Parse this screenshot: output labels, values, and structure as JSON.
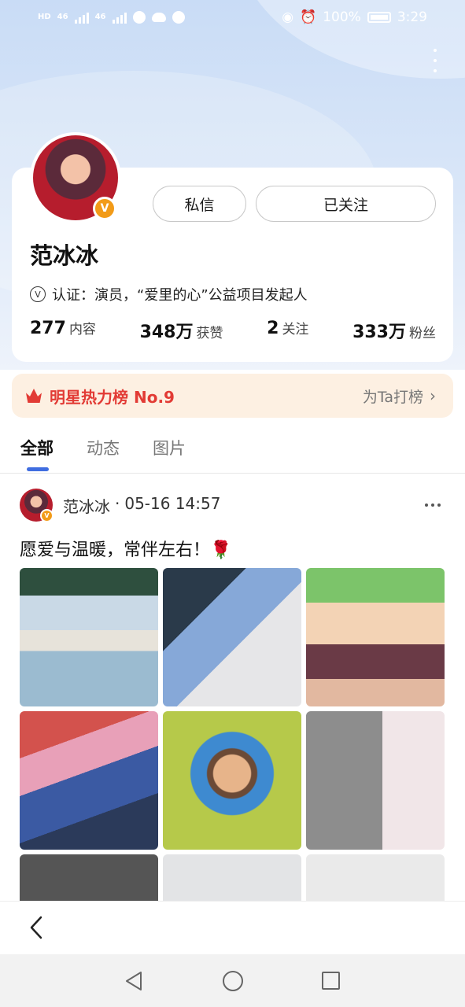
{
  "status_bar": {
    "network_chip": "HD",
    "signal1_label": "46",
    "signal2_label": "46",
    "battery": "100%",
    "time": "3:29"
  },
  "profile": {
    "name": "范冰冰",
    "verified_badge": "V",
    "cert_icon": "V",
    "cert_text": "认证：演员，“爱里的心”公益项目发起人",
    "message_button": "私信",
    "follow_button": "已关注",
    "stats": [
      {
        "num": "277",
        "label": "内容"
      },
      {
        "num": "348万",
        "label": "获赞"
      },
      {
        "num": "2",
        "label": "关注"
      },
      {
        "num": "333万",
        "label": "粉丝"
      }
    ]
  },
  "rank": {
    "title": "明星热力榜 No.9",
    "action": "为Ta打榜",
    "chevron": "›"
  },
  "tabs": [
    {
      "label": "全部",
      "active": true
    },
    {
      "label": "动态",
      "active": false
    },
    {
      "label": "图片",
      "active": false
    }
  ],
  "post": {
    "author": "范冰冰",
    "separator": "·",
    "time": "05-16 14:57",
    "text": "愿爱与温暖，常伴左右！🌹",
    "photo_count": 9
  },
  "colors": {
    "accent": "#3f6de0",
    "rank_red": "#e23b35",
    "rank_bg": "#fdf0e2",
    "badge": "#f29b18"
  },
  "icons": [
    "more-vertical-icon",
    "crown-icon",
    "verified-icon",
    "back-chevron-icon",
    "nav-back-icon",
    "nav-home-icon",
    "nav-recent-icon"
  ]
}
